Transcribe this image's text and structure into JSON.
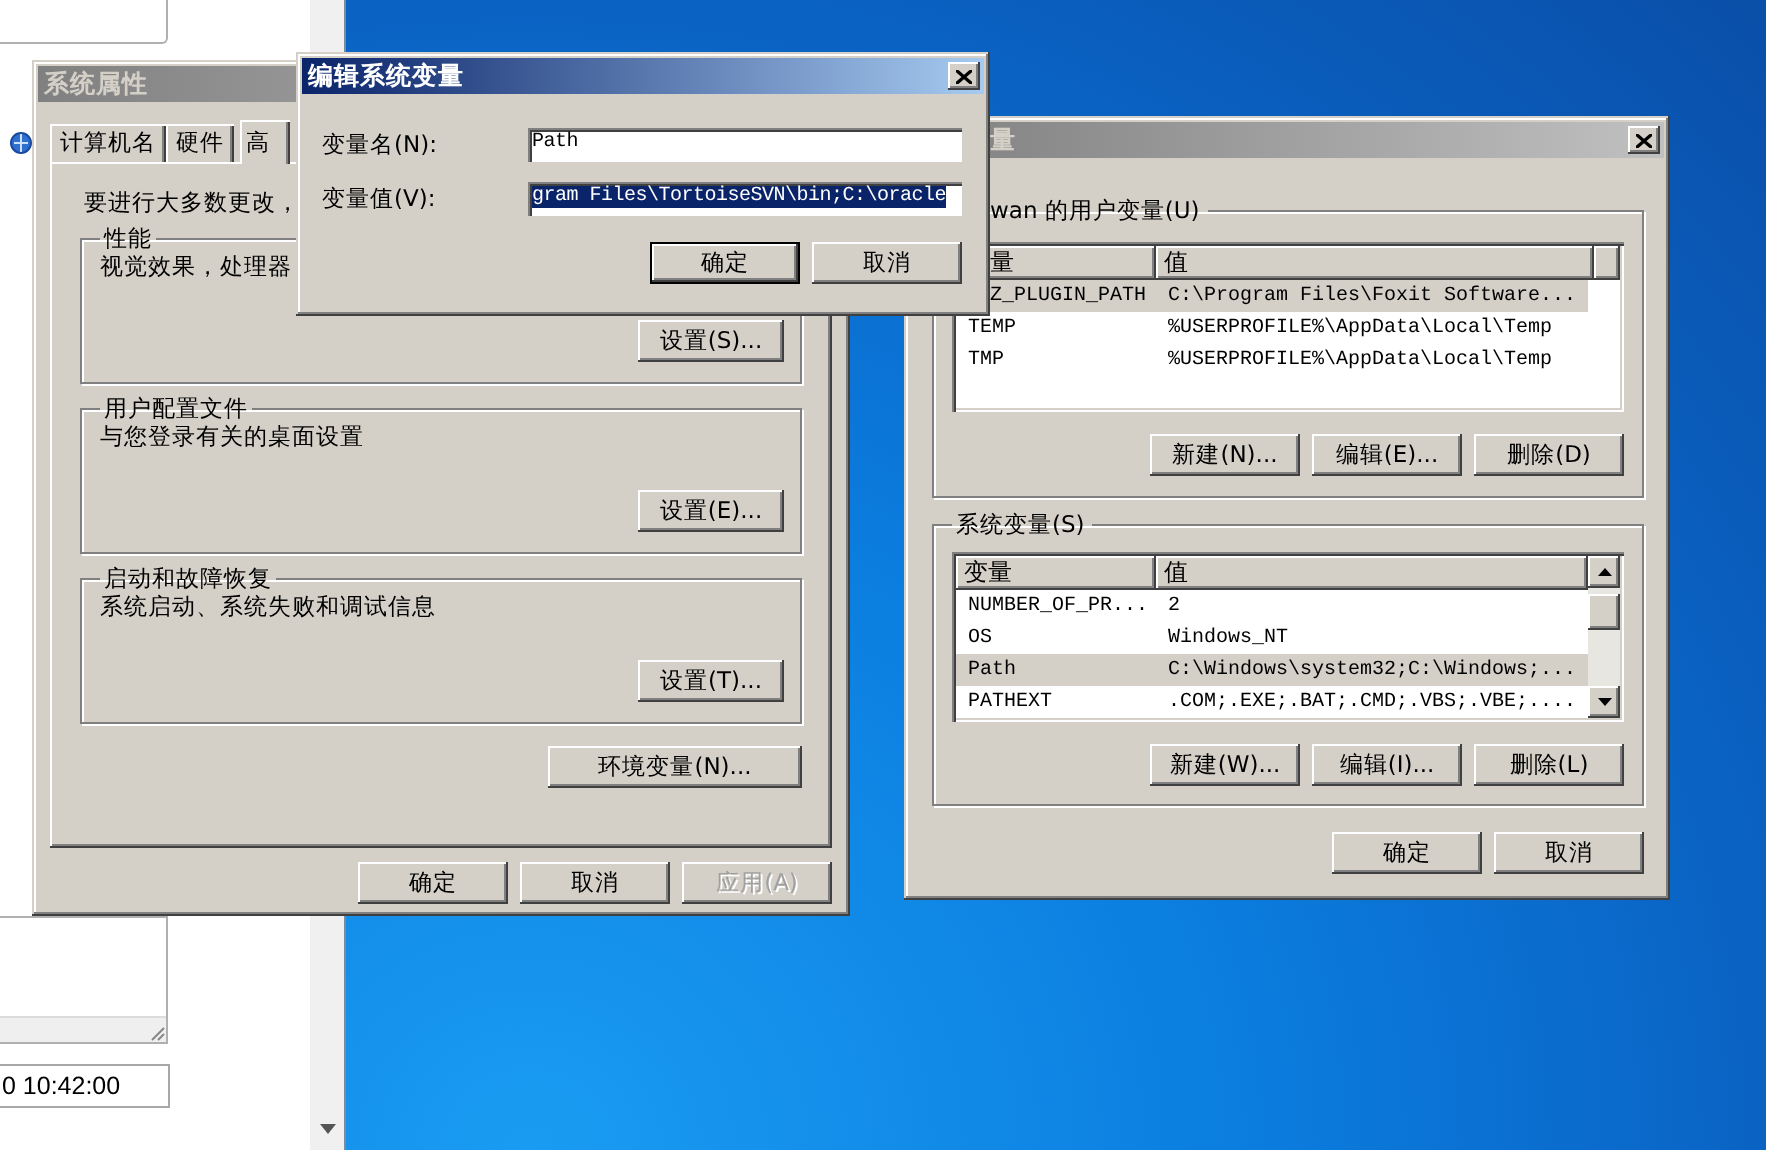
{
  "background_window": {
    "field_value": "0 10:42:00"
  },
  "system_properties": {
    "title": "系统属性",
    "active": false,
    "tabs": [
      {
        "label": "计算机名",
        "selected": false
      },
      {
        "label": "硬件",
        "selected": false
      },
      {
        "label": "高",
        "selected": true
      }
    ],
    "intro": "要进行大多数更改，",
    "groups": [
      {
        "title": "性能",
        "description": "视觉效果，处理器",
        "button": "设置(S)..."
      },
      {
        "title": "用户配置文件",
        "description": "与您登录有关的桌面设置",
        "button": "设置(E)..."
      },
      {
        "title": "启动和故障恢复",
        "description": "系统启动、系统失败和调试信息",
        "button": "设置(T)..."
      }
    ],
    "env_button": "环境变量(N)...",
    "buttons": [
      {
        "label": "确定",
        "disabled": false
      },
      {
        "label": "取消",
        "disabled": false
      },
      {
        "label": "应用(A)",
        "disabled": true
      }
    ]
  },
  "environment_variables": {
    "title": "量",
    "active": false,
    "user_variables": {
      "title": "wan 的用户变量(U)",
      "columns": [
        "量",
        "值"
      ],
      "rows": [
        {
          "name": "Z_PLUGIN_PATH",
          "value": "C:\\Program Files\\Foxit Software...",
          "selected": true
        },
        {
          "name": "TEMP",
          "value": "%USERPROFILE%\\AppData\\Local\\Temp",
          "selected": false
        },
        {
          "name": "TMP",
          "value": "%USERPROFILE%\\AppData\\Local\\Temp",
          "selected": false
        }
      ],
      "buttons": [
        "新建(N)...",
        "编辑(E)...",
        "删除(D)"
      ]
    },
    "system_variables": {
      "title": "系统变量(S)",
      "columns": [
        "变量",
        "值"
      ],
      "rows": [
        {
          "name": "NUMBER_OF_PR...",
          "value": "2",
          "selected": false
        },
        {
          "name": "OS",
          "value": "Windows_NT",
          "selected": false
        },
        {
          "name": "Path",
          "value": "C:\\Windows\\system32;C:\\Windows;...",
          "selected": true
        },
        {
          "name": "PATHEXT",
          "value": ".COM;.EXE;.BAT;.CMD;.VBS;.VBE;....",
          "selected": false
        }
      ],
      "buttons": [
        "新建(W)...",
        "编辑(I)...",
        "删除(L)"
      ]
    },
    "buttons": [
      "确定",
      "取消"
    ]
  },
  "edit_dialog": {
    "title": "编辑系统变量",
    "active": true,
    "fields": [
      {
        "label": "变量名(N):",
        "value": "Path",
        "selected": false
      },
      {
        "label": "变量值(V):",
        "value": "gram Files\\TortoiseSVN\\bin;C:\\oracle",
        "selected": true
      }
    ],
    "buttons": [
      {
        "label": "确定",
        "default": true
      },
      {
        "label": "取消",
        "default": false
      }
    ]
  }
}
